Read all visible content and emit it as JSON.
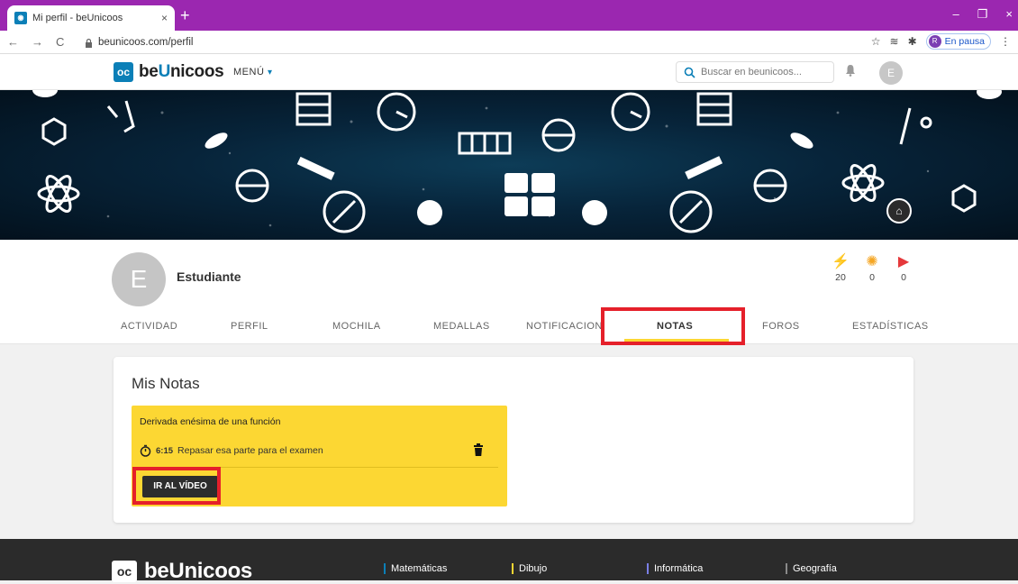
{
  "browser": {
    "tab_title": "Mi perfil - beUnicoos",
    "tab_close": "×",
    "new_tab": "+",
    "url": "beunicoos.com/perfil",
    "profile_initial": "R",
    "profile_status": "En pausa",
    "window_controls": [
      "–",
      "❐",
      "×"
    ]
  },
  "header": {
    "logo_mark": "oc",
    "logo_be": "be",
    "logo_u": "U",
    "logo_rest": "nicoos",
    "menu_label": "MENÚ",
    "search_placeholder": "Buscar en beunicoos...",
    "user_initial": "E"
  },
  "profile": {
    "avatar_initial": "E",
    "name": "Estudiante",
    "stats": [
      {
        "icon": "lightning-icon",
        "value": "20",
        "color": "#f5a623"
      },
      {
        "icon": "lightbulb-icon",
        "value": "0",
        "color": "#f5a623"
      },
      {
        "icon": "flag-icon",
        "value": "0",
        "color": "#e5383b"
      }
    ]
  },
  "tabs": [
    {
      "label": "ACTIVIDAD",
      "active": false
    },
    {
      "label": "PERFIL",
      "active": false
    },
    {
      "label": "MOCHILA",
      "active": false
    },
    {
      "label": "MEDALLAS",
      "active": false
    },
    {
      "label": "NOTIFICACIONES",
      "active": false
    },
    {
      "label": "NOTAS",
      "active": true
    },
    {
      "label": "FOROS",
      "active": false
    },
    {
      "label": "ESTADÍSTICAS",
      "active": false
    }
  ],
  "notes": {
    "title": "Mis Notas",
    "items": [
      {
        "title": "Derivada enésima de una función",
        "time": "6:15",
        "text": "Repasar esa parte para el examen",
        "button": "IR AL VÍDEO"
      }
    ]
  },
  "footer": {
    "logo_mark": "oc",
    "logo_text": "beUnicoos",
    "links": [
      "Matemáticas",
      "Dibujo",
      "Informática",
      "Geografía"
    ]
  },
  "colors": {
    "accent_blue": "#0b7fb7",
    "highlight_yellow": "#fcd733",
    "annotation_red": "#e5202a",
    "browser_purple": "#9b27b0"
  }
}
